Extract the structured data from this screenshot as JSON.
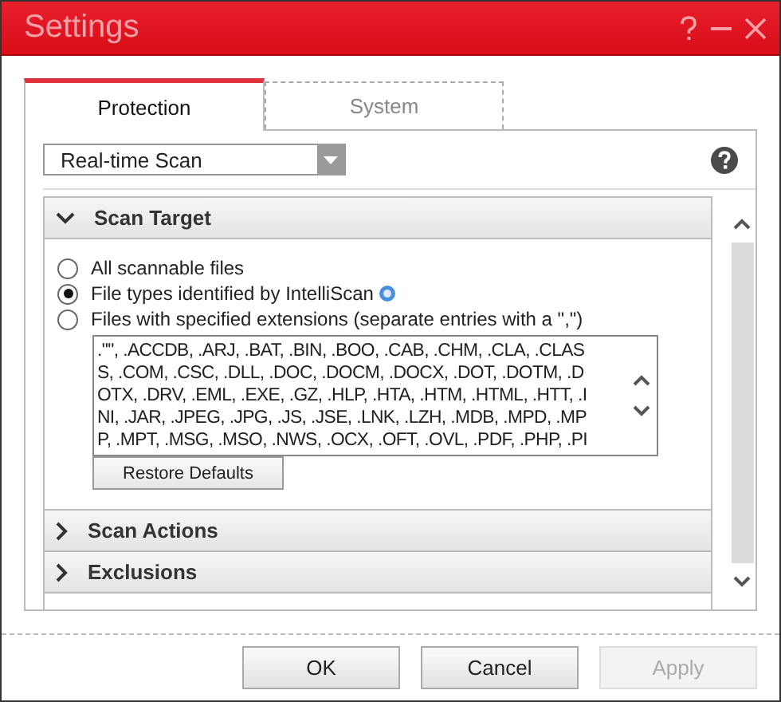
{
  "window": {
    "title": "Settings"
  },
  "tabs": [
    {
      "label": "Protection",
      "selected": true
    },
    {
      "label": "System",
      "selected": false
    }
  ],
  "scan_type": {
    "value": "Real-time Scan"
  },
  "sections": [
    {
      "title": "Scan Target",
      "expanded": true,
      "options": [
        {
          "label": "All scannable files",
          "selected": false,
          "info": false
        },
        {
          "label": "File types identified by IntelliScan",
          "selected": true,
          "info": true
        },
        {
          "label": "Files with specified extensions (separate entries with a \",\")",
          "selected": false,
          "info": false
        }
      ],
      "extension_lines": [
        ".\"\", .ACCDB, .ARJ, .BAT, .BIN, .BOO, .CAB, .CHM, .CLA, .CLAS",
        "S, .COM, .CSC, .DLL, .DOC, .DOCM, .DOCX, .DOT, .DOTM, .D",
        "OTX, .DRV, .EML, .EXE, .GZ, .HLP, .HTA, .HTM, .HTML, .HTT, .I",
        "NI, .JAR, .JPEG, .JPG, .JS, .JSE, .LNK, .LZH, .MDB, .MPD, .MP",
        "P, .MPT, .MSG, .MSO, .NWS, .OCX, .OFT, .OVL, .PDF, .PHP, .PI"
      ],
      "restore_button": "Restore Defaults"
    },
    {
      "title": "Scan Actions",
      "expanded": false
    },
    {
      "title": "Exclusions",
      "expanded": false
    }
  ],
  "buttons": [
    {
      "label": "OK",
      "disabled": false
    },
    {
      "label": "Cancel",
      "disabled": false
    },
    {
      "label": "Apply",
      "disabled": true
    }
  ]
}
